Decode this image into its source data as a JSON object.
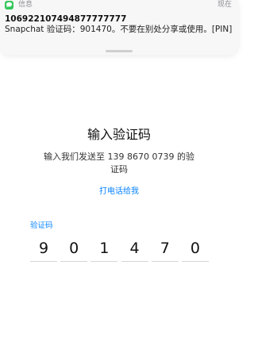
{
  "notification": {
    "app_name": "信息",
    "time": "现在",
    "sender": "106922107494877777777",
    "body": "Snapchat 验证码：901470。不要在别处分享或使用。[PIN]"
  },
  "main": {
    "title": "输入验证码",
    "subtitle": "输入我们发送至 139 8670 0739 的验证码",
    "call_link": "打电话给我",
    "code_label": "验证码",
    "digits": [
      "9",
      "0",
      "1",
      "4",
      "7",
      "0"
    ]
  },
  "colors": {
    "accent": "#0a84ff",
    "messages_green": "#34c759"
  },
  "icons": {
    "notification_app": "messages-icon"
  }
}
